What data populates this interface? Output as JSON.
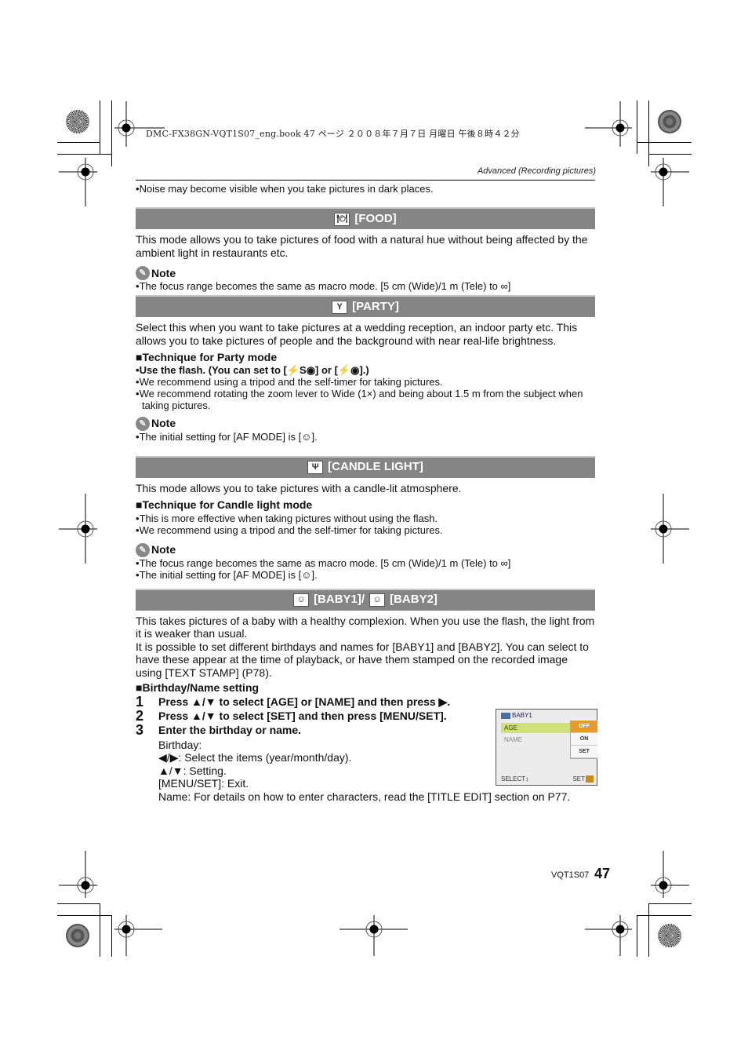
{
  "print_header": "DMC-FX38GN-VQT1S07_eng.book  47 ページ  ２００８年７月７日  月曜日  午後８時４２分",
  "running_head": "Advanced (Recording pictures)",
  "intro_bullet": "Noise may become visible when you take pictures in dark places.",
  "sections": {
    "food": {
      "icon": "food-icon",
      "title": "[FOOD]",
      "description": "This mode allows you to take pictures of food with a natural hue without being affected by the ambient light in restaurants etc.",
      "note_label": "Note",
      "notes": [
        "The focus range becomes the same as macro mode. [5 cm (Wide)/1 m (Tele) to ∞]"
      ]
    },
    "party": {
      "icon": "party-icon",
      "title": "[PARTY]",
      "description": "Select this when you want to take pictures at a wedding reception, an indoor party etc. This allows you to take pictures of people and the background with near real-life brightness.",
      "technique_title": "Technique for Party mode",
      "technique_bullets": [
        "Use the flash. (You can set to [⚡S◉] or [⚡◉].)",
        "We recommend using a tripod and the self-timer for taking pictures.",
        "We recommend rotating the zoom lever to Wide (1×) and being about 1.5 m from the subject when taking pictures."
      ],
      "note_label": "Note",
      "notes": [
        "The initial setting for [AF MODE] is [☺]."
      ]
    },
    "candle": {
      "icon": "candle-light-icon",
      "title": "[CANDLE LIGHT]",
      "description": "This mode allows you to take pictures with a candle-lit atmosphere.",
      "technique_title": "Technique for Candle light mode",
      "technique_bullets": [
        "This is more effective when taking pictures without using the flash.",
        "We recommend using a tripod and the self-timer for taking pictures."
      ],
      "note_label": "Note",
      "notes": [
        "The focus range becomes the same as macro mode. [5 cm (Wide)/1 m (Tele) to ∞]",
        "The initial setting for [AF MODE] is [☺]."
      ]
    },
    "baby": {
      "icon": "baby-icon",
      "title1": "[BABY1]/",
      "title2": "[BABY2]",
      "description1": "This takes pictures of a baby with a healthy complexion. When you use the flash, the light from it is weaker than usual.",
      "description2": "It is possible to set different birthdays and names for [BABY1] and [BABY2]. You can select to have these appear at the time of playback, or have them stamped on the recorded image using [TEXT STAMP] (P78).",
      "setting_title": "Birthday/Name setting",
      "steps": [
        {
          "num": "1",
          "text": "Press ▲/▼ to select [AGE] or [NAME] and then press ▶."
        },
        {
          "num": "2",
          "text": "Press ▲/▼ to select [SET] and then press [MENU/SET]."
        },
        {
          "num": "3",
          "text": "Enter the birthday or name."
        }
      ],
      "details": [
        "Birthday:",
        "◀/▶:  Select the items (year/month/day).",
        "▲/▼:  Setting.",
        "[MENU/SET]:  Exit.",
        "Name: For details on how to enter characters, read the [TITLE EDIT] section on P77."
      ]
    }
  },
  "lcd_screen": {
    "title": "BABY1",
    "items": [
      "AGE",
      "NAME"
    ],
    "selected_item": "AGE",
    "options": [
      "OFF",
      "ON",
      "SET"
    ],
    "selected_option": "OFF",
    "footer_left": "SELECT↕",
    "footer_right": "SET",
    "colors": {
      "selected_row": "#cfe07c",
      "selected_option": "#e89a2c"
    }
  },
  "footer": {
    "doc_code": "VQT1S07",
    "page_number": "47"
  },
  "colors": {
    "section_bar": "#858585",
    "section_text": "#ffffff"
  }
}
